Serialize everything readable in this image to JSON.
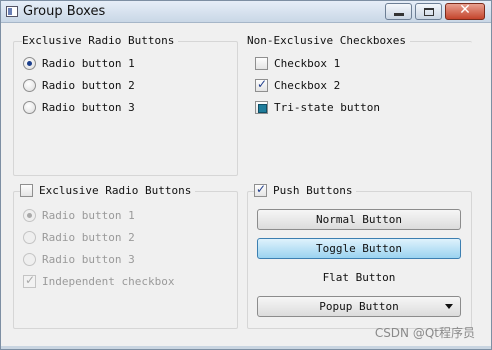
{
  "window": {
    "title": "Group Boxes",
    "close_glyph": "✕"
  },
  "groups": {
    "exclusive_radio": {
      "title": "Exclusive Radio Buttons",
      "radios": [
        {
          "label": "Radio button 1",
          "checked": true
        },
        {
          "label": "Radio button 2",
          "checked": false
        },
        {
          "label": "Radio button 3",
          "checked": false
        }
      ]
    },
    "non_exclusive": {
      "title": "Non-Exclusive Checkboxes",
      "checkboxes": [
        {
          "label": "Checkbox 1",
          "state": "unchecked"
        },
        {
          "label": "Checkbox 2",
          "state": "checked"
        },
        {
          "label": "Tri-state button",
          "state": "partial"
        }
      ]
    },
    "checkable_exclusive": {
      "title": "Exclusive Radio Buttons",
      "title_checked": false,
      "radios": [
        {
          "label": "Radio button 1",
          "checked": true
        },
        {
          "label": "Radio button 2",
          "checked": false
        },
        {
          "label": "Radio button 3",
          "checked": false
        }
      ],
      "independent": {
        "label": "Independent checkbox",
        "checked": true
      }
    },
    "push_buttons": {
      "title": "Push Buttons",
      "title_checked": true,
      "normal_label": "Normal Button",
      "toggle_label": "Toggle Button",
      "flat_label": "Flat Button",
      "popup_label": "Popup Button"
    }
  },
  "watermark": "CSDN @Qt程序员",
  "colors": {
    "toggle_accent": "#9bd3f0",
    "radio_dot": "#1c3f8c",
    "tri_state": "#1f7d9b"
  }
}
